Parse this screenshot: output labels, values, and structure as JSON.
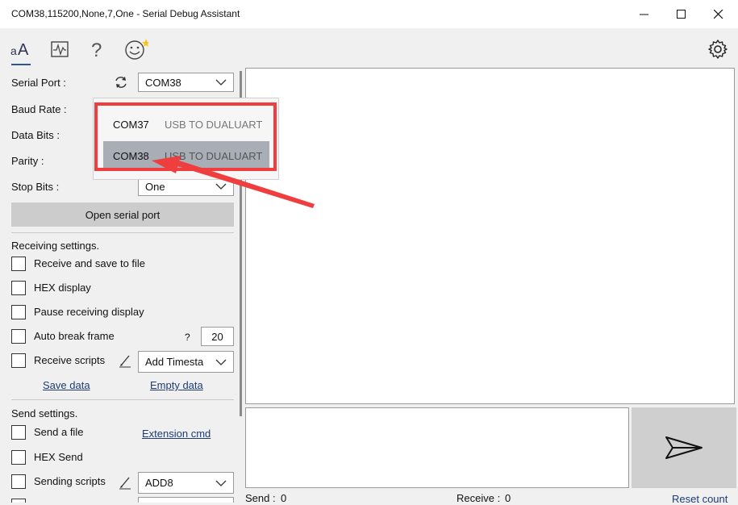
{
  "window": {
    "title": "COM38,115200,None,7,One - Serial Debug Assistant"
  },
  "toolbar": {
    "icons": [
      "font-icon",
      "waveform-icon",
      "help-icon",
      "smiley-icon",
      "settings-icon"
    ]
  },
  "serial": {
    "port_label": "Serial Port :",
    "port_value": "COM38",
    "baud_label": "Baud Rate :",
    "databits_label": "Data Bits :",
    "parity_label": "Parity :",
    "stopbits_label": "Stop Bits :",
    "stopbits_value": "One",
    "open_button": "Open serial port"
  },
  "port_dropdown": {
    "items": [
      {
        "port": "COM37",
        "desc": "USB TO DUALUART"
      },
      {
        "port": "COM38",
        "desc": "USB TO DUALUART"
      }
    ],
    "selected": "COM38"
  },
  "receiving": {
    "header": "Receiving settings.",
    "save_to_file": "Receive and save to file",
    "hex_display": "HEX display",
    "pause_display": "Pause receiving display",
    "auto_break": "Auto break frame",
    "auto_break_help": "?",
    "auto_break_value": "20",
    "receive_scripts": "Receive scripts",
    "timestamp_option": "Add Timesta",
    "save_data": "Save data",
    "empty_data": "Empty data"
  },
  "sending": {
    "header": "Send settings.",
    "send_file": "Send a file",
    "extension_cmd": "Extension cmd",
    "hex_send": "HEX Send",
    "sending_scripts": "Sending scripts",
    "scripts_option": "ADD8"
  },
  "status": {
    "send_label": "Send :",
    "send_count": "0",
    "receive_label": "Receive :",
    "receive_count": "0",
    "reset_count": "Reset count"
  },
  "colors": {
    "highlight_border": "#f03e3e",
    "selected_row": "#a9adb5",
    "arrow": "#f03e3e"
  }
}
